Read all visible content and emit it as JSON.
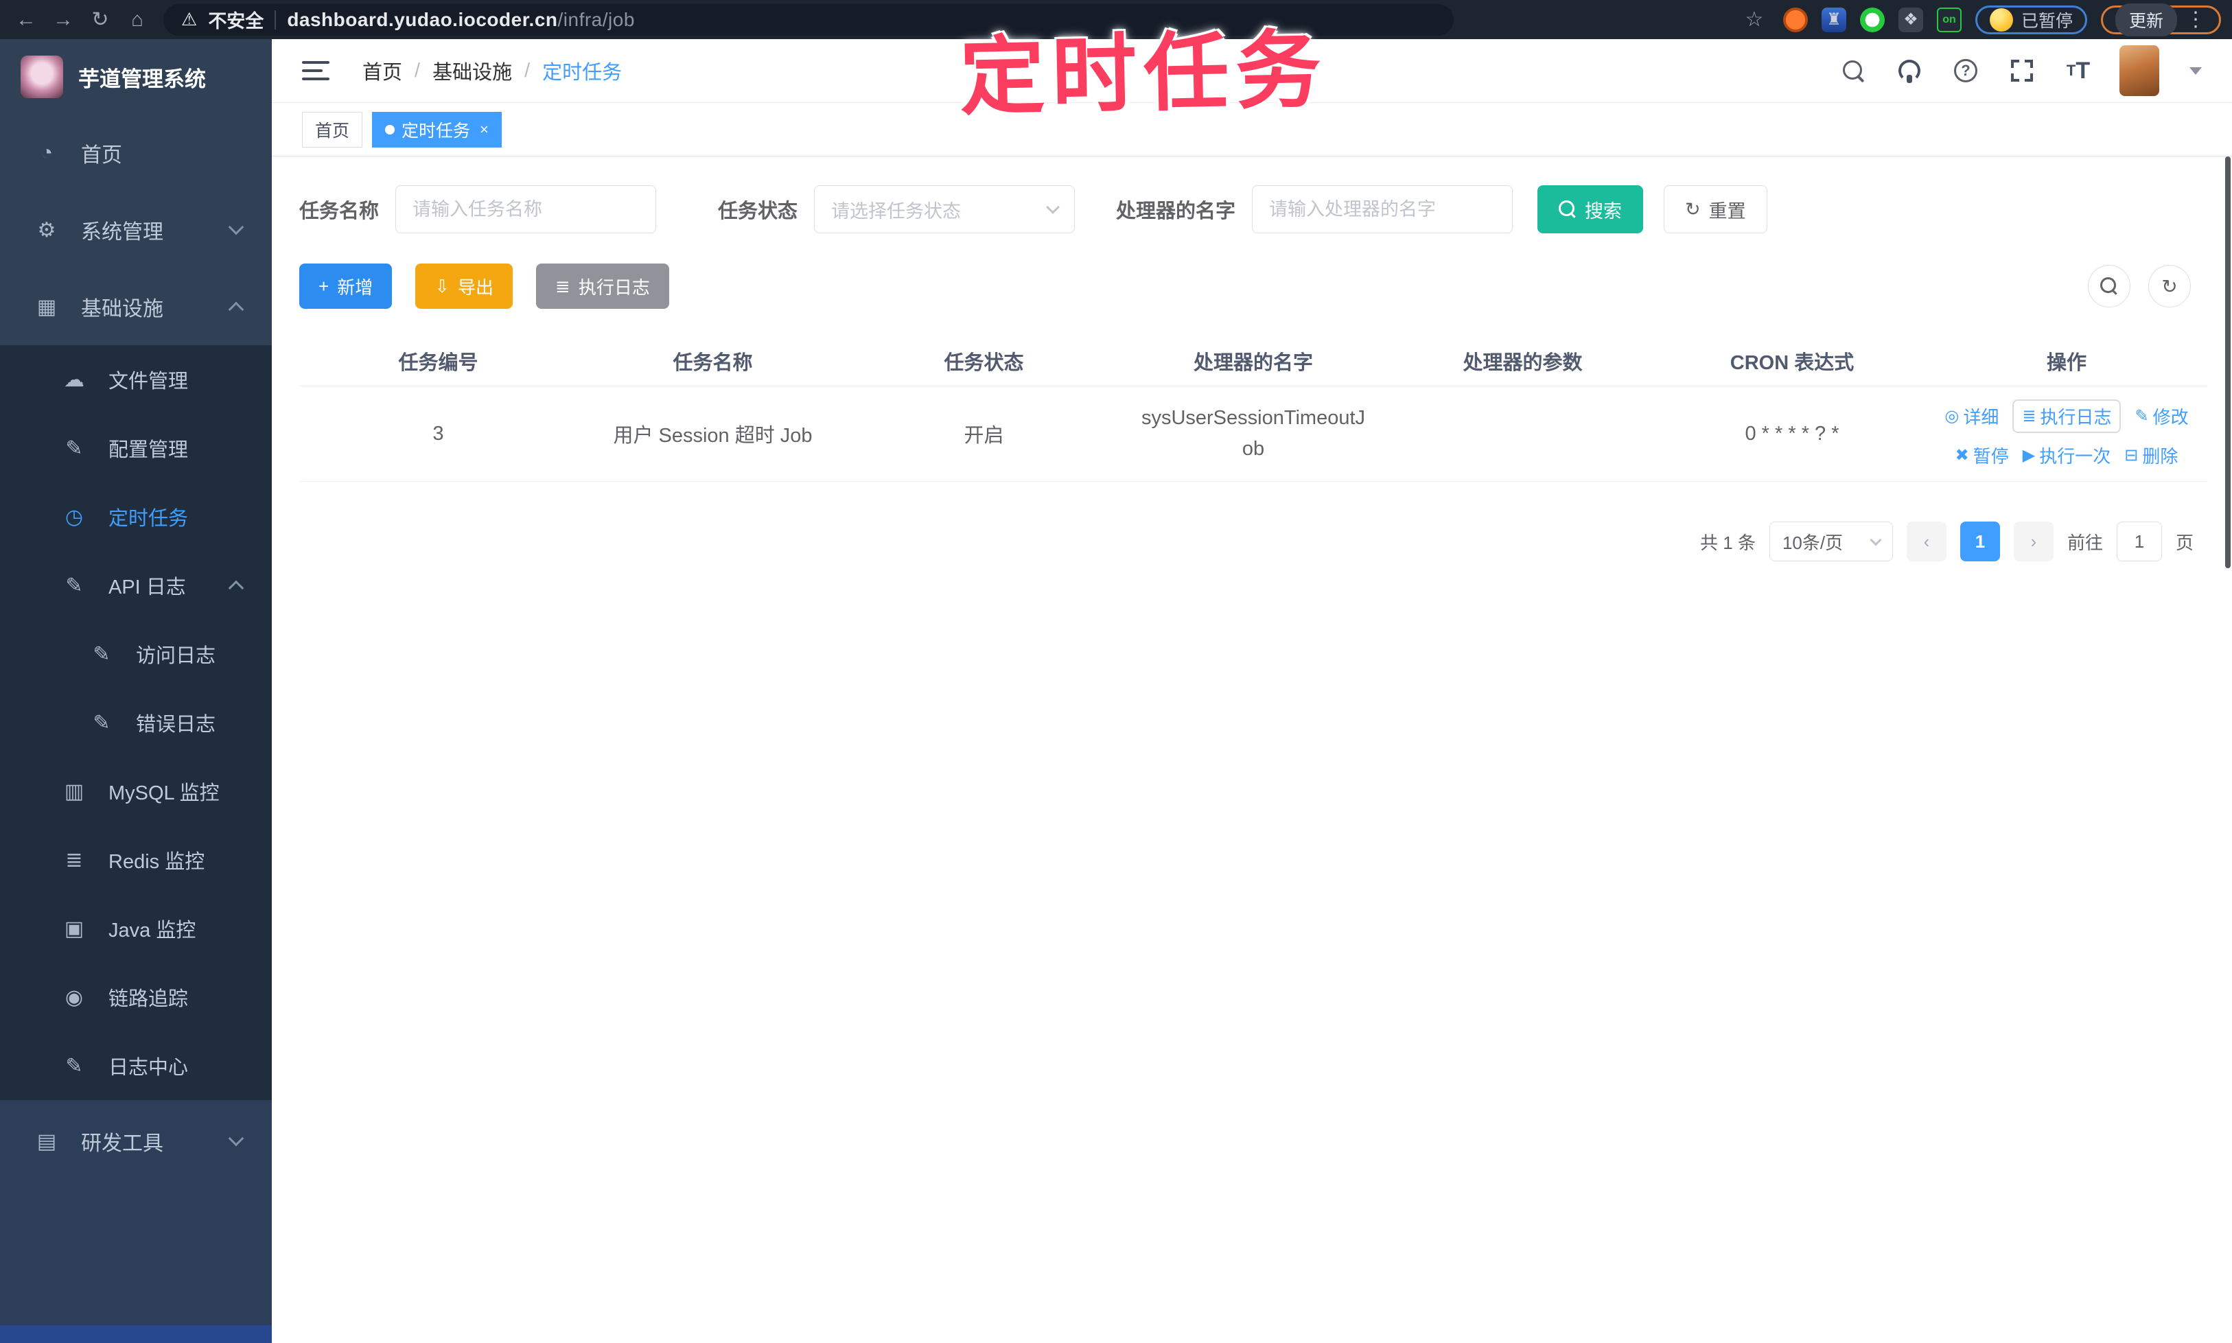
{
  "browser": {
    "security_warning": "不安全",
    "url_domain": "dashboard.yudao.iocoder.cn",
    "url_path": "/infra/job",
    "extension_on_badge": "on",
    "paused_badge": "已暂停",
    "update_button": "更新"
  },
  "annotation": {
    "text": "定时任务",
    "color": "#fb3e5f"
  },
  "sidebar": {
    "logo_title": "芋道管理系统",
    "items": [
      {
        "label": "首页"
      },
      {
        "label": "系统管理"
      },
      {
        "label": "基础设施"
      },
      {
        "label": "文件管理"
      },
      {
        "label": "配置管理"
      },
      {
        "label": "定时任务"
      },
      {
        "label": "API 日志"
      },
      {
        "label": "访问日志"
      },
      {
        "label": "错误日志"
      },
      {
        "label": "MySQL 监控"
      },
      {
        "label": "Redis 监控"
      },
      {
        "label": "Java 监控"
      },
      {
        "label": "链路追踪"
      },
      {
        "label": "日志中心"
      },
      {
        "label": "研发工具"
      }
    ]
  },
  "header": {
    "breadcrumb": [
      "首页",
      "基础设施",
      "定时任务"
    ]
  },
  "tags": [
    {
      "label": "首页"
    },
    {
      "label": "定时任务",
      "close": "×"
    }
  ],
  "filters": {
    "name_label": "任务名称",
    "name_placeholder": "请输入任务名称",
    "status_label": "任务状态",
    "status_placeholder": "请选择任务状态",
    "handler_label": "处理器的名字",
    "handler_placeholder": "请输入处理器的名字",
    "search_label": "搜索",
    "reset_label": "重置"
  },
  "toolbar": {
    "add_label": "新增",
    "export_label": "导出",
    "exec_log_label": "执行日志"
  },
  "table": {
    "columns": [
      "任务编号",
      "任务名称",
      "任务状态",
      "处理器的名字",
      "处理器的参数",
      "CRON 表达式",
      "操作"
    ],
    "row": {
      "id": "3",
      "name": "用户 Session 超时 Job",
      "status": "开启",
      "handler": "sysUserSessionTimeoutJob",
      "params": "",
      "cron": "0 * * * * ? *"
    },
    "actions": {
      "detail": "详细",
      "exec_log": "执行日志",
      "modify": "修改",
      "pause": "暂停",
      "run_once": "执行一次",
      "delete": "删除"
    }
  },
  "pagination": {
    "total": "共 1 条",
    "page_size": "10条/页",
    "current_page": "1",
    "goto_label": "前往",
    "goto_value": "1",
    "page_suffix": "页"
  }
}
